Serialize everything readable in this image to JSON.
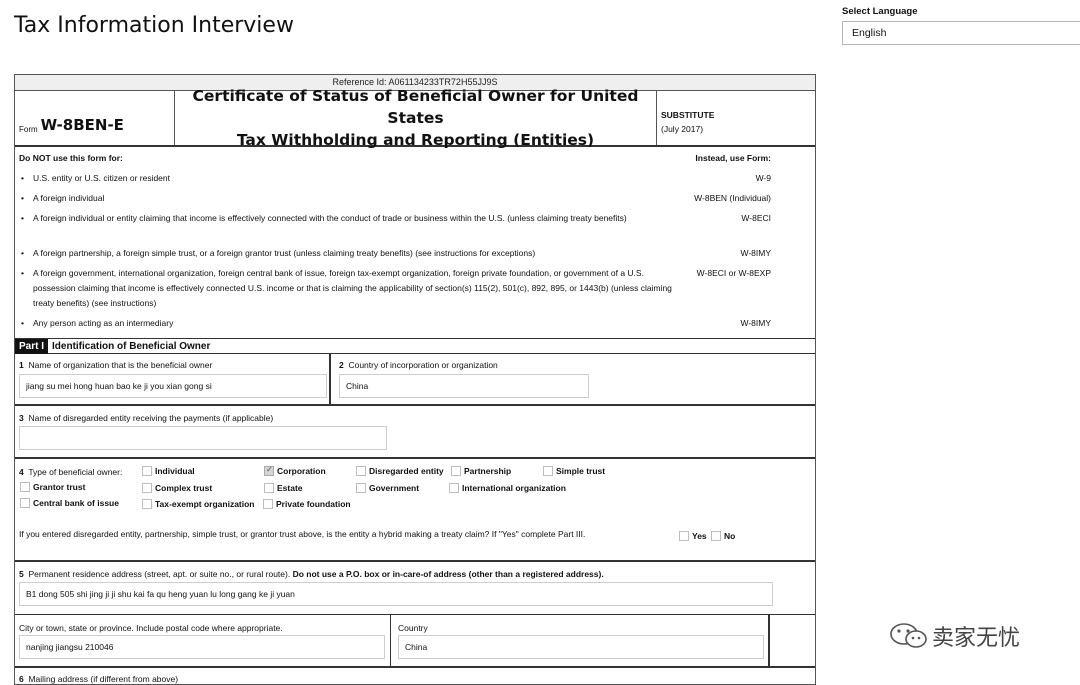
{
  "page": {
    "title": "Tax Information Interview"
  },
  "language": {
    "label": "Select Language",
    "selected": "English"
  },
  "form": {
    "reference": "Reference Id: A061134233TR72H55JJ9S",
    "form_label": "Form",
    "form_name": "W-8BEN-E",
    "title_line1": "Certificate of Status of Beneficial Owner for United States",
    "title_line2": "Tax Withholding and Reporting (Entities)",
    "substitute": "SUBSTITUTE",
    "date": "(July 2017)",
    "donot_header": "Do NOT use this form for:",
    "instead_header": "Instead, use Form:",
    "donot_rows": [
      {
        "text": "U.S. entity or U.S. citizen or resident",
        "form": "W-9"
      },
      {
        "text": "A foreign individual",
        "form": "W-8BEN (Individual)"
      },
      {
        "text": "A foreign individual or entity claiming that income is effectively connected with the conduct of trade or business within the U.S. (unless claiming treaty benefits)",
        "form": "W-8ECI"
      },
      {
        "text": "A foreign partnership, a foreign simple trust, or a foreign grantor trust (unless claiming treaty benefits) (see instructions for exceptions)",
        "form": "W-8IMY"
      },
      {
        "text": "A foreign government, international organization, foreign central bank of issue, foreign tax-exempt organization, foreign private foundation, or government of a U.S. possession claiming that income is effectively connected U.S. income or that is claiming the applicability of section(s) 115(2), 501(c), 892, 895, or 1443(b) (unless claiming treaty benefits) (see instructions)",
        "form": "W-8ECI or W-8EXP"
      },
      {
        "text": "Any person acting as an intermediary",
        "form": "W-8IMY"
      }
    ],
    "part1": {
      "tag": "Part I",
      "title": "Identification of Beneficial Owner"
    },
    "field1": {
      "num": "1",
      "label": "Name of organization that is the beneficial owner",
      "value": "jiang su mei hong huan bao ke ji you xian gong si"
    },
    "field2": {
      "num": "2",
      "label": "Country of incorporation or organization",
      "value": "China"
    },
    "field3": {
      "num": "3",
      "label": "Name of disregarded entity receiving the payments (if applicable)",
      "value": ""
    },
    "field4": {
      "num": "4",
      "label": "Type of beneficial owner:",
      "options": [
        {
          "label": "Individual",
          "checked": false
        },
        {
          "label": "Corporation",
          "checked": true
        },
        {
          "label": "Disregarded entity",
          "checked": false
        },
        {
          "label": "Partnership",
          "checked": false
        },
        {
          "label": "Simple trust",
          "checked": false
        },
        {
          "label": "Grantor trust",
          "checked": false
        },
        {
          "label": "Complex trust",
          "checked": false
        },
        {
          "label": "Estate",
          "checked": false
        },
        {
          "label": "Government",
          "checked": false
        },
        {
          "label": "International organization",
          "checked": false
        },
        {
          "label": "Central bank of issue",
          "checked": false
        },
        {
          "label": "Tax-exempt organization",
          "checked": false
        },
        {
          "label": "Private foundation",
          "checked": false
        }
      ],
      "hybrid_question": "If you entered disregarded entity, partnership, simple trust, or grantor trust above, is the entity a hybrid making a treaty claim? If \"Yes\" complete Part III.",
      "yes": "Yes",
      "no": "No"
    },
    "field5": {
      "num": "5",
      "label_plain": "Permanent residence address (street, apt. or suite no., or rural route).",
      "label_bold": "Do not use a P.O. box or in-care-of address (other than a registered address).",
      "value": "B1 dong 505 shi jing ji ji shu kai fa qu heng yuan lu long gang ke ji yuan",
      "city_label": "City or town, state or province. Include postal code where appropriate.",
      "city_value": "nanjing jiangsu 210046",
      "country_label": "Country",
      "country_value": "China"
    },
    "field6": {
      "num": "6",
      "label": "Mailing address (if different from above)"
    }
  },
  "watermark": {
    "text": "卖家无忧"
  }
}
